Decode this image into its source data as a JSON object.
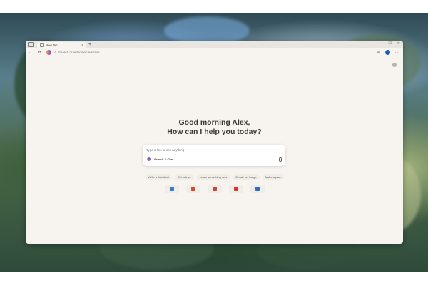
{
  "browser": {
    "tab_title": "New tab",
    "tab_close": "×",
    "new_tab": "+",
    "window_controls": [
      "–",
      "☐",
      "✕"
    ],
    "back": "←",
    "refresh": "⟳",
    "address_placeholder": "Search or enter web address",
    "extensions_icon": "⊕",
    "menu": "⋯"
  },
  "newtab": {
    "greeting_line1": "Good morning Alex,",
    "greeting_line2": "How can I help you today?",
    "chat_placeholder": "Type a link or ask anything",
    "mode_label": "Search & Chat",
    "mode_chevron": "⌄",
    "suggestions": [
      "Write a first draft",
      "Get advice",
      "Learn something new",
      "Create an image",
      "Make a plan"
    ],
    "shortcuts": [
      {
        "icon": "edge-icon",
        "color": "#2f7be0"
      },
      {
        "icon": "office-icon",
        "color": "#e0452f"
      },
      {
        "icon": "figma-icon",
        "color": "#c9473a"
      },
      {
        "icon": "youtube-icon",
        "color": "#e0302b"
      },
      {
        "icon": "linkedin-icon",
        "color": "#2d6fbf"
      }
    ]
  },
  "colors": {
    "window_bg": "#f7f4f0",
    "accent": "#1f5db8"
  }
}
